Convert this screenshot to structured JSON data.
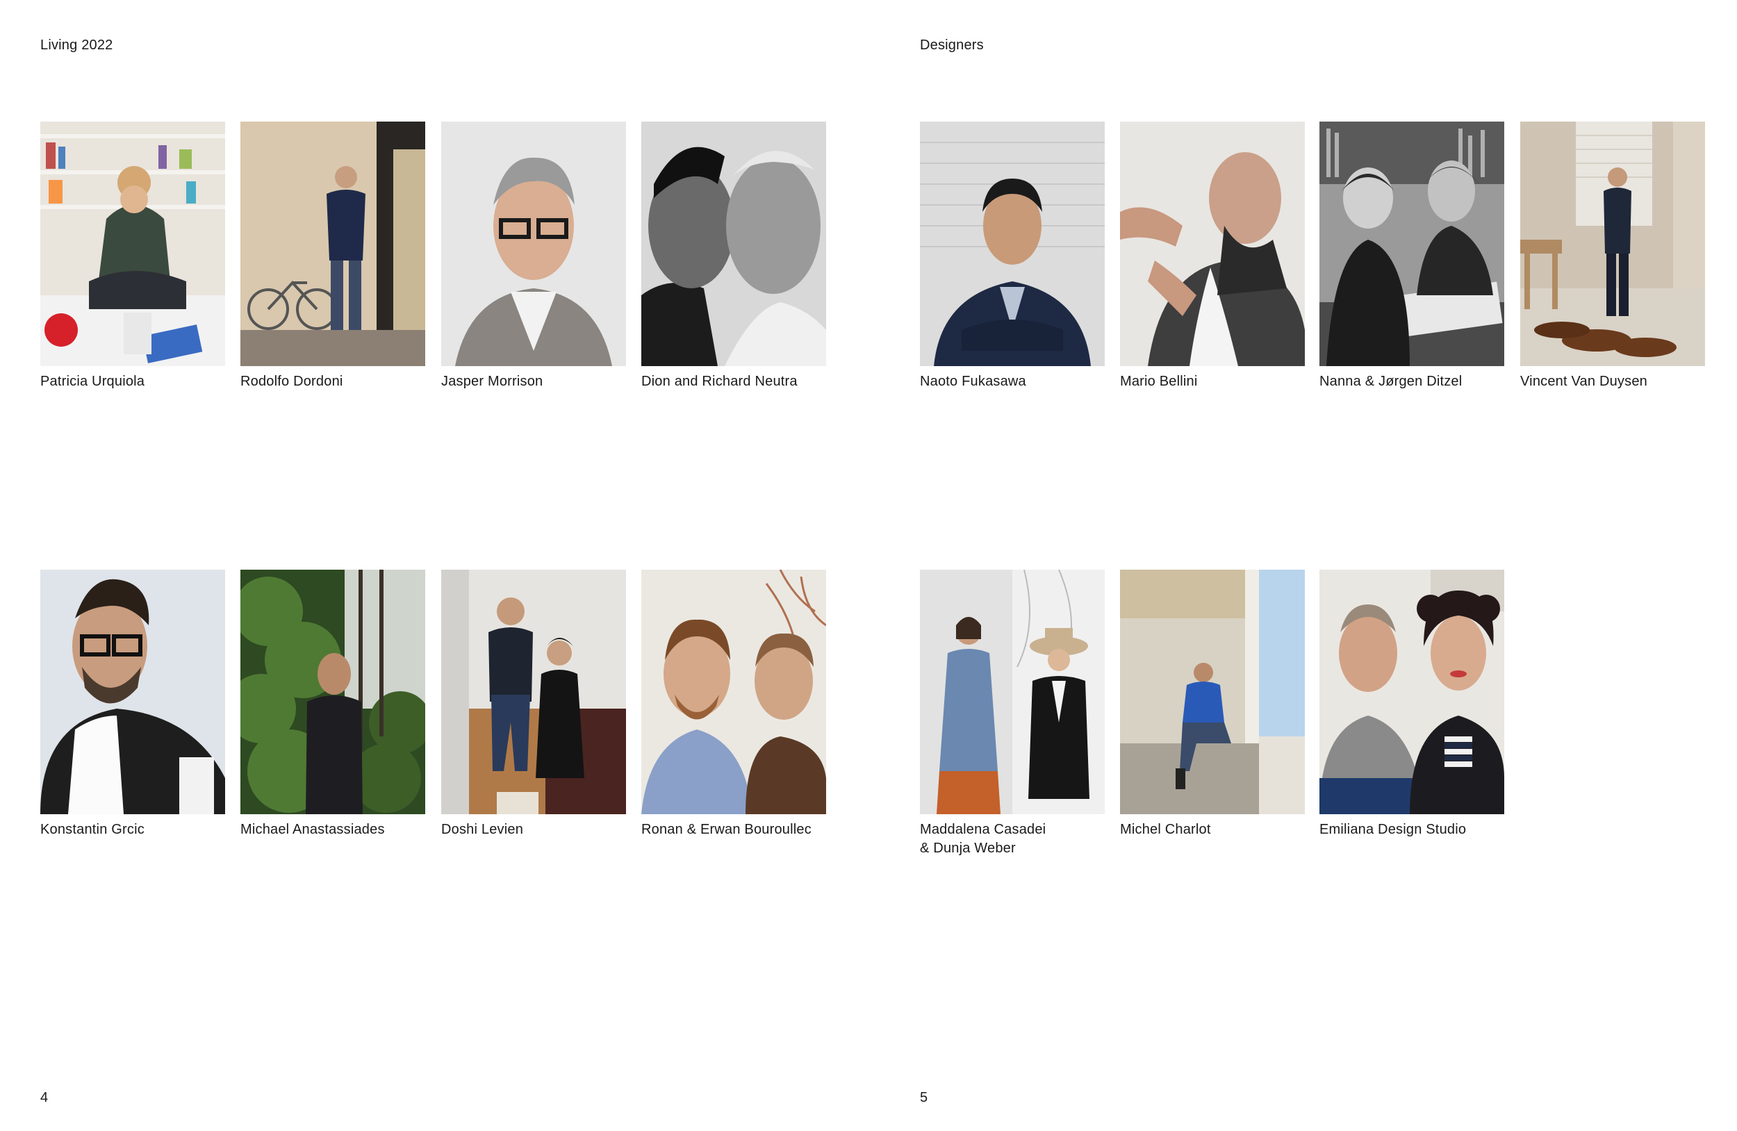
{
  "left_page": {
    "header": "Living 2022",
    "page_number": "4",
    "row1": [
      {
        "caption": "Patricia Urquiola"
      },
      {
        "caption": "Rodolfo Dordoni"
      },
      {
        "caption": "Jasper Morrison"
      },
      {
        "caption": "Dion and Richard Neutra"
      }
    ],
    "row2": [
      {
        "caption": "Konstantin Grcic"
      },
      {
        "caption": "Michael Anastassiades"
      },
      {
        "caption": "Doshi Levien"
      },
      {
        "caption": "Ronan & Erwan Bouroullec"
      }
    ]
  },
  "right_page": {
    "header": "Designers",
    "page_number": "5",
    "row1": [
      {
        "caption": "Naoto Fukasawa"
      },
      {
        "caption": "Mario Bellini"
      },
      {
        "caption": "Nanna & Jørgen Ditzel"
      },
      {
        "caption": "Vincent Van Duysen"
      }
    ],
    "row2": [
      {
        "caption_line1": "Maddalena Casadei",
        "caption_line2": "& Dunja Weber"
      },
      {
        "caption": "Michel Charlot"
      },
      {
        "caption": "Emiliana Design Studio"
      }
    ]
  }
}
